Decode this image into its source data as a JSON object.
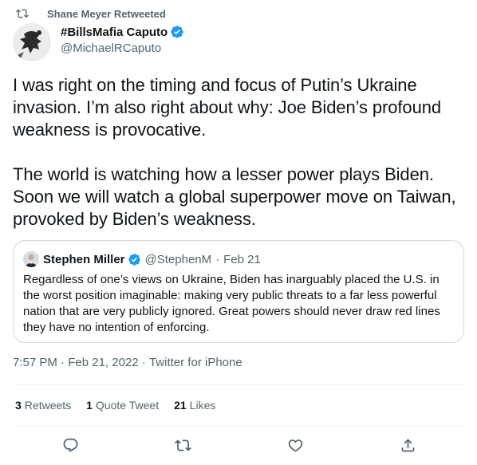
{
  "retweet_context": {
    "text": "Shane Meyer Retweeted",
    "icon": "retweet-icon"
  },
  "tweet": {
    "author_name": "#BillsMafia Caputo",
    "author_handle": "@MichaelRCaputo",
    "verified": true,
    "text": "I was right on the timing and focus of Putin’s Ukraine invasion. I’m also right about why: Joe Biden’s profound weakness is provocative.\n\nThe world is watching how a lesser power plays Biden. Soon we will watch a global superpower move on Taiwan, provoked by Biden’s weakness."
  },
  "quote": {
    "author_name": "Stephen Miller",
    "author_handle": "@StephenM",
    "separator": "·",
    "date": "Feb 21",
    "verified": true,
    "text": "Regardless of one’s views on Ukraine, Biden has inarguably placed the U.S. in the worst position imaginable: making very public threats to a far less powerful nation that are very publicly ignored. Great powers should never draw red lines they have no intention of enforcing."
  },
  "meta": {
    "time": "7:57 PM",
    "separator": " · ",
    "date": "Feb 21, 2022",
    "source": "Twitter for iPhone"
  },
  "stats": {
    "retweets_count": "3",
    "retweets_label": "Retweets",
    "quotes_count": "1",
    "quotes_label": "Quote Tweet",
    "likes_count": "21",
    "likes_label": "Likes"
  },
  "actions": [
    "reply-icon",
    "retweet-icon",
    "like-icon",
    "share-icon"
  ],
  "colors": {
    "text": "#0f1419",
    "secondary": "#536471",
    "verified": "#1d9bf0",
    "border": "#cfd9de",
    "divider": "#eff3f4"
  }
}
